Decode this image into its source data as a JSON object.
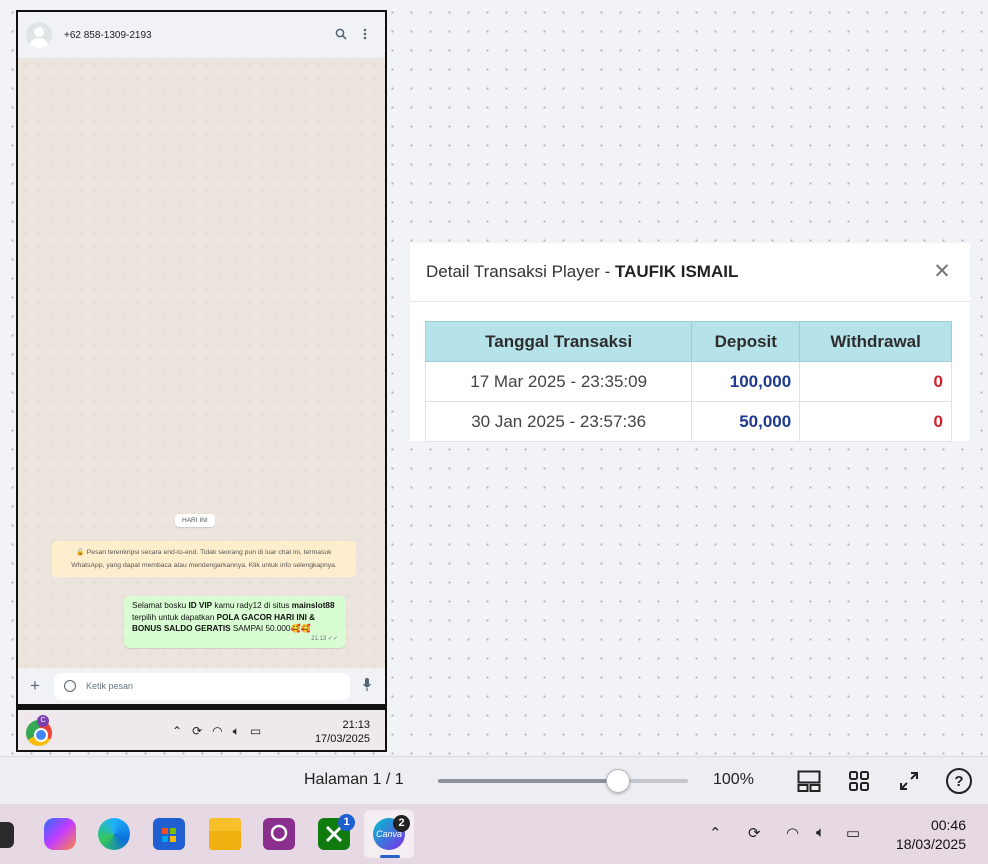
{
  "whatsapp": {
    "contact_name": "+62 858-1309-2193",
    "date_chip": "HARI INI",
    "encryption_note": "🔒 Pesan terenkripsi secara end-to-end. Tidak seorang pun di luar chat ini, termasuk WhatsApp, yang dapat membaca atau mendengarkannya. Klik untuk info selengkapnya.",
    "message": {
      "t1": "Selamat bosku ",
      "b1": "ID VIP",
      "t2": " kamu rady12 di situs ",
      "b2": "mainslot88",
      "t3": " terpilih untuk dapatkan ",
      "b3": "POLA GACOR HARI INI & BONUS SALDO GERATIS",
      "t4": "  SAMPAI 50.000🥰🥰",
      "time": "21.13 ✓✓"
    },
    "input_placeholder": "Ketik pesan",
    "icons": [
      "search-icon",
      "more-vert-icon",
      "plus-icon",
      "sticker-icon",
      "mic-icon"
    ]
  },
  "phone_taskbar": {
    "chrome_badge": "C",
    "time": "21:13",
    "date": "17/03/2025"
  },
  "transaction_panel": {
    "title_prefix": "Detail Transaksi Player - ",
    "player_name": "TAUFIK ISMAIL",
    "close_symbol": "✕",
    "columns": [
      "Tanggal Transaksi",
      "Deposit",
      "Withdrawal"
    ],
    "rows": [
      {
        "date": "17 Mar 2025 - 23:35:09",
        "deposit": "100,000",
        "withdrawal": "0"
      },
      {
        "date": "30 Jan 2025 - 23:57:36",
        "deposit": "50,000",
        "withdrawal": "0"
      }
    ],
    "colors": {
      "header_bg": "#b6e2ea",
      "deposit": "#1f3b8f",
      "withdrawal": "#d0202a"
    }
  },
  "page_toolbar": {
    "page_label": "Halaman 1 / 1",
    "zoom_percent": "100%",
    "zoom_slider_fraction": 0.72
  },
  "windows_taskbar": {
    "apps": [
      "copilot-icon",
      "edge-icon",
      "store-icon",
      "file-explorer-icon",
      "app-icon",
      "xbox-icon",
      "canva-icon"
    ],
    "xbox_badge": "1",
    "canva_badge": "2",
    "canva_label": "Canva",
    "time": "00:46",
    "date": "18/03/2025"
  }
}
